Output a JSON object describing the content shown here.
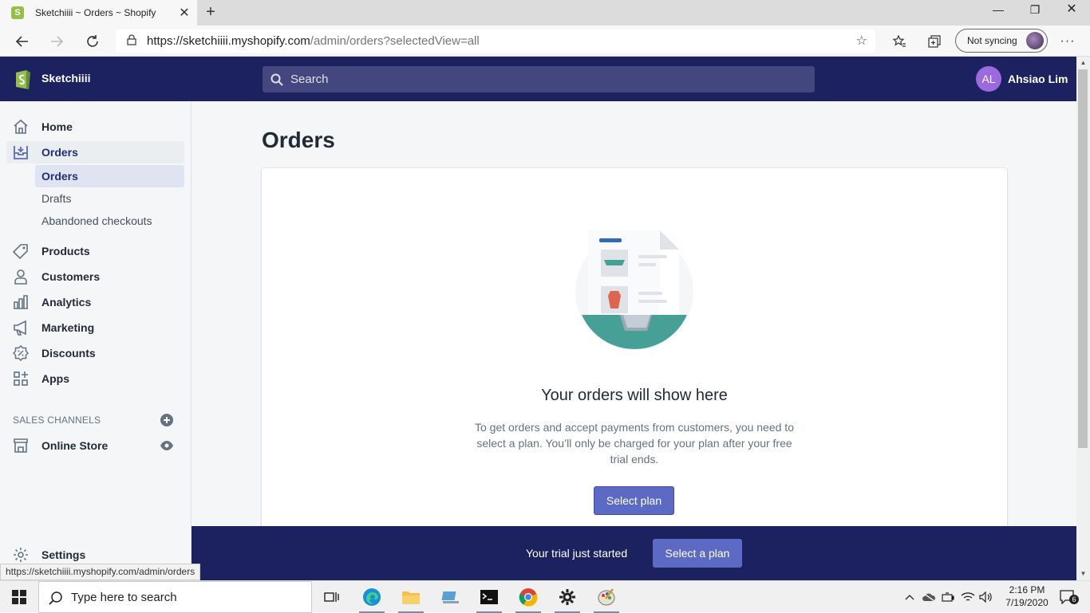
{
  "browser": {
    "tab_title": "Sketchiiii ~ Orders ~ Shopify",
    "favicon_letter": "S",
    "new_tab": "+",
    "url_host": "https://sketchiiii.myshopify.com",
    "url_path": "/admin/orders?selectedView=all",
    "sync_label": "Not syncing",
    "status_link": "https://sketchiiii.myshopify.com/admin/orders"
  },
  "topbar": {
    "store_name": "Sketchiiii",
    "search_placeholder": "Search",
    "avatar_initials": "AL",
    "user_name": "Ahsiao Lim"
  },
  "sidebar": {
    "items": [
      {
        "label": "Home",
        "icon": "home-icon"
      },
      {
        "label": "Orders",
        "icon": "orders-icon"
      },
      {
        "label": "Products",
        "icon": "tag-icon"
      },
      {
        "label": "Customers",
        "icon": "person-icon"
      },
      {
        "label": "Analytics",
        "icon": "bar-chart-icon"
      },
      {
        "label": "Marketing",
        "icon": "megaphone-icon"
      },
      {
        "label": "Discounts",
        "icon": "discount-icon"
      },
      {
        "label": "Apps",
        "icon": "apps-icon"
      }
    ],
    "order_subitems": [
      "Orders",
      "Drafts",
      "Abandoned checkouts"
    ],
    "sales_channels_title": "SALES CHANNELS",
    "online_store": "Online Store",
    "settings": "Settings"
  },
  "main": {
    "page_title": "Orders",
    "empty_title": "Your orders will show here",
    "empty_description": "To get orders and accept payments from customers, you need to select a plan. You’ll only be charged for your plan after your free trial ends.",
    "select_plan_button": "Select plan"
  },
  "trial_banner": {
    "text": "Your trial just started",
    "button": "Select a plan"
  },
  "taskbar": {
    "search_placeholder": "Type here to search",
    "time": "2:16 PM",
    "date": "7/19/2020",
    "notification_count": "6"
  },
  "colors": {
    "topbar": "#1c2260",
    "primary_button": "#5c6ac4",
    "sidebar_bg": "#f4f6f8"
  }
}
